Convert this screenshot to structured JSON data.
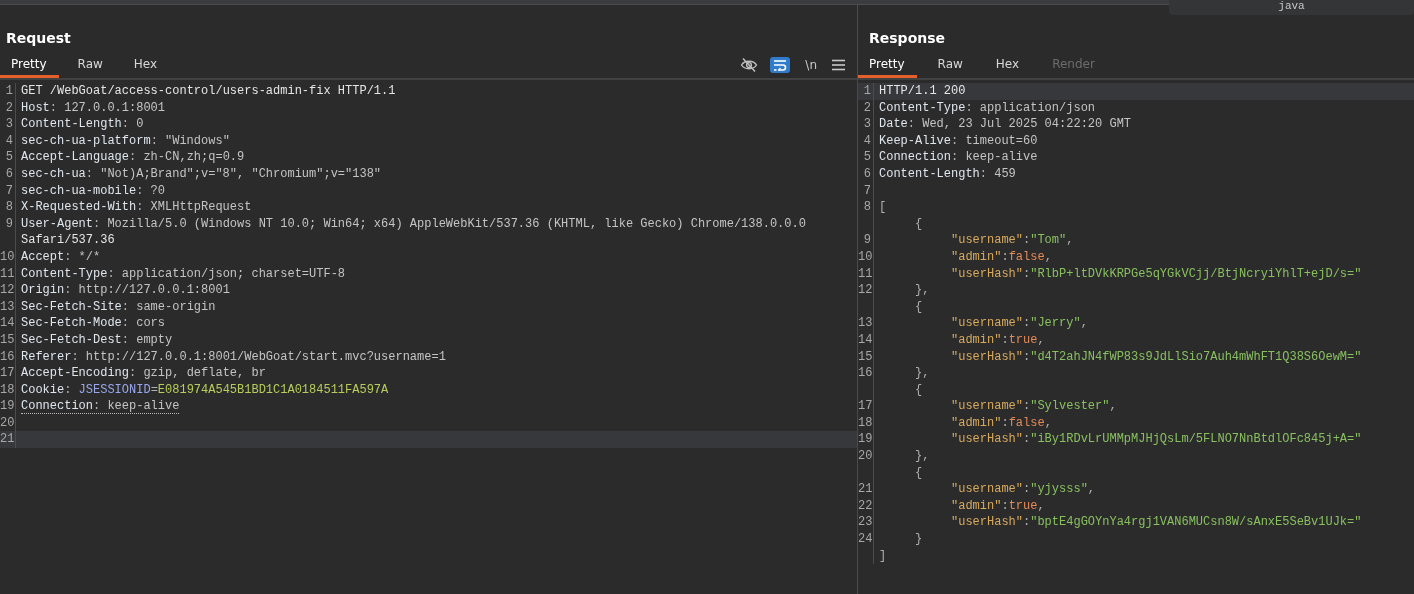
{
  "popup": {
    "text": "java"
  },
  "request": {
    "title": "Request",
    "tabs": [
      {
        "label": "Pretty",
        "selected": true,
        "disabled": false
      },
      {
        "label": "Raw",
        "selected": false,
        "disabled": false
      },
      {
        "label": "Hex",
        "selected": false,
        "disabled": false
      }
    ],
    "tools": [
      {
        "kind": "hide"
      },
      {
        "kind": "wrap",
        "on": true
      },
      {
        "kind": "newline",
        "label": "\\n",
        "on": false
      },
      {
        "kind": "menu"
      }
    ],
    "rows": [
      {
        "number": "1",
        "current": false,
        "flagged": false,
        "segments": [
          {
            "kind": "text",
            "text": "GET /WebGoat/access-control/users-admin-fix HTTP/1.1"
          }
        ]
      },
      {
        "number": "2",
        "current": false,
        "flagged": false,
        "segments": [
          {
            "kind": "key",
            "text": "Host"
          },
          {
            "kind": "punct",
            "text": ":"
          },
          {
            "kind": "value",
            "text": "127.0.0.1:8001"
          }
        ]
      },
      {
        "number": "3",
        "current": false,
        "flagged": false,
        "segments": [
          {
            "kind": "key",
            "text": "Content-Length"
          },
          {
            "kind": "punct",
            "text": ":"
          },
          {
            "kind": "value",
            "text": "0"
          }
        ]
      },
      {
        "number": "4",
        "current": false,
        "flagged": false,
        "segments": [
          {
            "kind": "key",
            "text": "sec-ch-ua-platform"
          },
          {
            "kind": "punct",
            "text": ":"
          },
          {
            "kind": "value",
            "text": "\"Windows\""
          }
        ]
      },
      {
        "number": "5",
        "current": false,
        "flagged": false,
        "segments": [
          {
            "kind": "key",
            "text": "Accept-Language"
          },
          {
            "kind": "punct",
            "text": ":"
          },
          {
            "kind": "value",
            "text": "zh-CN,zh;q=0.9"
          }
        ]
      },
      {
        "number": "6",
        "current": false,
        "flagged": false,
        "segments": [
          {
            "kind": "key",
            "text": "sec-ch-ua"
          },
          {
            "kind": "punct",
            "text": ":"
          },
          {
            "kind": "value",
            "text": "\"Not)A;Brand\";v=\"8\", \"Chromium\";v=\"138\""
          }
        ]
      },
      {
        "number": "7",
        "current": false,
        "flagged": false,
        "segments": [
          {
            "kind": "key",
            "text": "sec-ch-ua-mobile"
          },
          {
            "kind": "punct",
            "text": ":"
          },
          {
            "kind": "value",
            "text": "?0"
          }
        ]
      },
      {
        "number": "8",
        "current": false,
        "flagged": false,
        "segments": [
          {
            "kind": "key",
            "text": "X-Requested-With"
          },
          {
            "kind": "punct",
            "text": ":"
          },
          {
            "kind": "value",
            "text": "XMLHttpRequest"
          }
        ]
      },
      {
        "number": "9",
        "current": false,
        "flagged": false,
        "segments": [
          {
            "kind": "key",
            "text": "User-Agent"
          },
          {
            "kind": "punct",
            "text": ":"
          },
          {
            "kind": "value",
            "text": "Mozilla/5.0 (Windows NT 10.0; Win64; x64) AppleWebKit/537.36 (KHTML, like Gecko) Chrome/138.0.0.0"
          }
        ]
      },
      {
        "current": false,
        "flagged": false,
        "segments": [
          {
            "kind": "text",
            "text": "Safari/537.36"
          }
        ]
      },
      {
        "number": "10",
        "current": false,
        "flagged": false,
        "segments": [
          {
            "kind": "key",
            "text": "Accept"
          },
          {
            "kind": "punct",
            "text": ":"
          },
          {
            "kind": "value",
            "text": "*/*"
          }
        ]
      },
      {
        "number": "11",
        "current": false,
        "flagged": false,
        "segments": [
          {
            "kind": "key",
            "text": "Content-Type"
          },
          {
            "kind": "punct",
            "text": ":"
          },
          {
            "kind": "value",
            "text": "application/json; charset=UTF-8"
          }
        ]
      },
      {
        "number": "12",
        "current": false,
        "flagged": false,
        "segments": [
          {
            "kind": "key",
            "text": "Origin"
          },
          {
            "kind": "punct",
            "text": ":"
          },
          {
            "kind": "value",
            "text": "http://127.0.0.1:8001"
          }
        ]
      },
      {
        "number": "13",
        "current": false,
        "flagged": false,
        "segments": [
          {
            "kind": "key",
            "text": "Sec-Fetch-Site"
          },
          {
            "kind": "punct",
            "text": ":"
          },
          {
            "kind": "value",
            "text": "same-origin"
          }
        ]
      },
      {
        "number": "14",
        "current": false,
        "flagged": false,
        "segments": [
          {
            "kind": "key",
            "text": "Sec-Fetch-Mode"
          },
          {
            "kind": "punct",
            "text": ":"
          },
          {
            "kind": "value",
            "text": "cors"
          }
        ]
      },
      {
        "number": "15",
        "current": false,
        "flagged": false,
        "segments": [
          {
            "kind": "key",
            "text": "Sec-Fetch-Dest"
          },
          {
            "kind": "punct",
            "text": ":"
          },
          {
            "kind": "value",
            "text": "empty"
          }
        ]
      },
      {
        "number": "16",
        "current": false,
        "flagged": false,
        "segments": [
          {
            "kind": "key",
            "text": "Referer"
          },
          {
            "kind": "punct",
            "text": ":"
          },
          {
            "kind": "value",
            "text": "http://127.0.0.1:8001/WebGoat/start.mvc?username=1"
          }
        ]
      },
      {
        "number": "17",
        "current": false,
        "flagged": false,
        "segments": [
          {
            "kind": "key",
            "text": "Accept-Encoding"
          },
          {
            "kind": "punct",
            "text": ":"
          },
          {
            "kind": "value",
            "text": "gzip, deflate, br"
          }
        ]
      },
      {
        "number": "18",
        "current": false,
        "flagged": false,
        "segments": [
          {
            "kind": "key",
            "text": "Cookie"
          },
          {
            "kind": "punct",
            "text": ":"
          },
          {
            "kind": "cookie_name",
            "text": "JSESSIONID"
          },
          {
            "kind": "eq",
            "text": "="
          },
          {
            "kind": "cookie_value",
            "text": "E081974A545B1BD1C1A0184511FA597A"
          }
        ]
      },
      {
        "number": "19",
        "current": false,
        "flagged": true,
        "segments": [
          {
            "kind": "key",
            "text": "Connection"
          },
          {
            "kind": "punct",
            "text": ":"
          },
          {
            "kind": "value",
            "text": "keep-alive"
          }
        ]
      },
      {
        "number": "20",
        "current": false,
        "segments": []
      },
      {
        "number": "21",
        "current": true,
        "segments": []
      }
    ]
  },
  "response": {
    "title": "Response",
    "tabs": [
      {
        "label": "Pretty",
        "selected": true,
        "disabled": false
      },
      {
        "label": "Raw",
        "selected": false,
        "disabled": false
      },
      {
        "label": "Hex",
        "selected": false,
        "disabled": false
      },
      {
        "label": "Render",
        "selected": false,
        "disabled": true
      }
    ],
    "rows": [
      {
        "number": "1",
        "current": true,
        "kind": "plain",
        "segments": [
          {
            "kind": "text",
            "text": "HTTP/1.1 200"
          }
        ]
      },
      {
        "number": "2",
        "current": false,
        "kind": "plain",
        "segments": [
          {
            "kind": "key",
            "text": "Content-Type"
          },
          {
            "kind": "punct",
            "text": ":"
          },
          {
            "kind": "value",
            "text": "application/json"
          }
        ]
      },
      {
        "number": "3",
        "current": false,
        "kind": "plain",
        "segments": [
          {
            "kind": "key",
            "text": "Date"
          },
          {
            "kind": "punct",
            "text": ":"
          },
          {
            "kind": "value",
            "text": "Wed, 23 Jul 2025 04:22:20 GMT"
          }
        ]
      },
      {
        "number": "4",
        "current": false,
        "kind": "plain",
        "segments": [
          {
            "kind": "key",
            "text": "Keep-Alive"
          },
          {
            "kind": "punct",
            "text": ":"
          },
          {
            "kind": "value",
            "text": "timeout=60"
          }
        ]
      },
      {
        "number": "5",
        "current": false,
        "kind": "plain",
        "segments": [
          {
            "kind": "key",
            "text": "Connection"
          },
          {
            "kind": "punct",
            "text": ":"
          },
          {
            "kind": "value",
            "text": "keep-alive"
          }
        ]
      },
      {
        "number": "6",
        "current": false,
        "kind": "plain",
        "segments": [
          {
            "kind": "key",
            "text": "Content-Length"
          },
          {
            "kind": "punct",
            "text": ":"
          },
          {
            "kind": "value",
            "text": "459"
          }
        ]
      },
      {
        "number": "7",
        "current": false,
        "segments": []
      },
      {
        "number": "8",
        "current": false,
        "kind": "plain",
        "segments": [
          {
            "kind": "jpunct",
            "text": "["
          }
        ]
      },
      {
        "current": false,
        "kind": "brace",
        "segments": [
          {
            "kind": "jpunct",
            "text": "{"
          }
        ]
      },
      {
        "number": "9",
        "current": false,
        "kind": "member",
        "segments": [
          {
            "kind": "json_key",
            "text": "\"username\""
          },
          {
            "kind": "jpunct",
            "text": ":"
          },
          {
            "kind": "json_string",
            "text": "\"Tom\""
          },
          {
            "kind": "jpunct",
            "text": ","
          }
        ]
      },
      {
        "number": "10",
        "current": false,
        "kind": "member",
        "segments": [
          {
            "kind": "json_key",
            "text": "\"admin\""
          },
          {
            "kind": "jpunct",
            "text": ":"
          },
          {
            "kind": "json_bool",
            "text": "false"
          },
          {
            "kind": "jpunct",
            "text": ","
          }
        ]
      },
      {
        "number": "11",
        "current": false,
        "kind": "member",
        "segments": [
          {
            "kind": "json_key",
            "text": "\"userHash\""
          },
          {
            "kind": "jpunct",
            "text": ":"
          },
          {
            "kind": "json_string",
            "text": "\"RlbP+ltDVkKRPGe5qYGkVCjj/BtjNcryiYhlT+ejD/s=\""
          }
        ]
      },
      {
        "number": "12",
        "current": false,
        "kind": "brace",
        "segments": [
          {
            "kind": "jpunct",
            "text": "},"
          }
        ]
      },
      {
        "current": false,
        "kind": "brace",
        "segments": [
          {
            "kind": "jpunct",
            "text": "{"
          }
        ]
      },
      {
        "number": "13",
        "current": false,
        "kind": "member",
        "segments": [
          {
            "kind": "json_key",
            "text": "\"username\""
          },
          {
            "kind": "jpunct",
            "text": ":"
          },
          {
            "kind": "json_string",
            "text": "\"Jerry\""
          },
          {
            "kind": "jpunct",
            "text": ","
          }
        ]
      },
      {
        "number": "14",
        "current": false,
        "kind": "member",
        "segments": [
          {
            "kind": "json_key",
            "text": "\"admin\""
          },
          {
            "kind": "jpunct",
            "text": ":"
          },
          {
            "kind": "json_bool",
            "text": "true"
          },
          {
            "kind": "jpunct",
            "text": ","
          }
        ]
      },
      {
        "number": "15",
        "current": false,
        "kind": "member",
        "segments": [
          {
            "kind": "json_key",
            "text": "\"userHash\""
          },
          {
            "kind": "jpunct",
            "text": ":"
          },
          {
            "kind": "json_string",
            "text": "\"d4T2ahJN4fWP83s9JdLlSio7Auh4mWhFT1Q38S6OewM=\""
          }
        ]
      },
      {
        "number": "16",
        "current": false,
        "kind": "brace",
        "segments": [
          {
            "kind": "jpunct",
            "text": "},"
          }
        ]
      },
      {
        "current": false,
        "kind": "brace",
        "segments": [
          {
            "kind": "jpunct",
            "text": "{"
          }
        ]
      },
      {
        "number": "17",
        "current": false,
        "kind": "member",
        "segments": [
          {
            "kind": "json_key",
            "text": "\"username\""
          },
          {
            "kind": "jpunct",
            "text": ":"
          },
          {
            "kind": "json_string",
            "text": "\"Sylvester\""
          },
          {
            "kind": "jpunct",
            "text": ","
          }
        ]
      },
      {
        "number": "18",
        "current": false,
        "kind": "member",
        "segments": [
          {
            "kind": "json_key",
            "text": "\"admin\""
          },
          {
            "kind": "jpunct",
            "text": ":"
          },
          {
            "kind": "json_bool",
            "text": "false"
          },
          {
            "kind": "jpunct",
            "text": ","
          }
        ]
      },
      {
        "number": "19",
        "current": false,
        "kind": "member",
        "segments": [
          {
            "kind": "json_key",
            "text": "\"userHash\""
          },
          {
            "kind": "jpunct",
            "text": ":"
          },
          {
            "kind": "json_string",
            "text": "\"iBy1RDvLrUMMpMJHjQsLm/5FLNO7NnBtdlOFc845j+A=\""
          }
        ]
      },
      {
        "number": "20",
        "current": false,
        "kind": "brace",
        "segments": [
          {
            "kind": "jpunct",
            "text": "},"
          }
        ]
      },
      {
        "current": false,
        "kind": "brace",
        "segments": [
          {
            "kind": "jpunct",
            "text": "{"
          }
        ]
      },
      {
        "number": "21",
        "current": false,
        "kind": "member",
        "segments": [
          {
            "kind": "json_key",
            "text": "\"username\""
          },
          {
            "kind": "jpunct",
            "text": ":"
          },
          {
            "kind": "json_string",
            "text": "\"yjysss\""
          },
          {
            "kind": "jpunct",
            "text": ","
          }
        ]
      },
      {
        "number": "22",
        "current": false,
        "kind": "member",
        "segments": [
          {
            "kind": "json_key",
            "text": "\"admin\""
          },
          {
            "kind": "jpunct",
            "text": ":"
          },
          {
            "kind": "json_bool",
            "text": "true"
          },
          {
            "kind": "jpunct",
            "text": ","
          }
        ]
      },
      {
        "number": "23",
        "current": false,
        "kind": "member",
        "segments": [
          {
            "kind": "json_key",
            "text": "\"userHash\""
          },
          {
            "kind": "jpunct",
            "text": ":"
          },
          {
            "kind": "json_string",
            "text": "\"bptE4gGOYnYa4rgj1VAN6MUCsn8W/sAnxE5SeBv1UJk=\""
          }
        ]
      },
      {
        "number": "24",
        "current": false,
        "kind": "brace",
        "segments": [
          {
            "kind": "jpunct",
            "text": "}"
          }
        ]
      },
      {
        "current": false,
        "kind": "plain",
        "segments": [
          {
            "kind": "jpunct",
            "text": "]"
          }
        ]
      }
    ]
  }
}
